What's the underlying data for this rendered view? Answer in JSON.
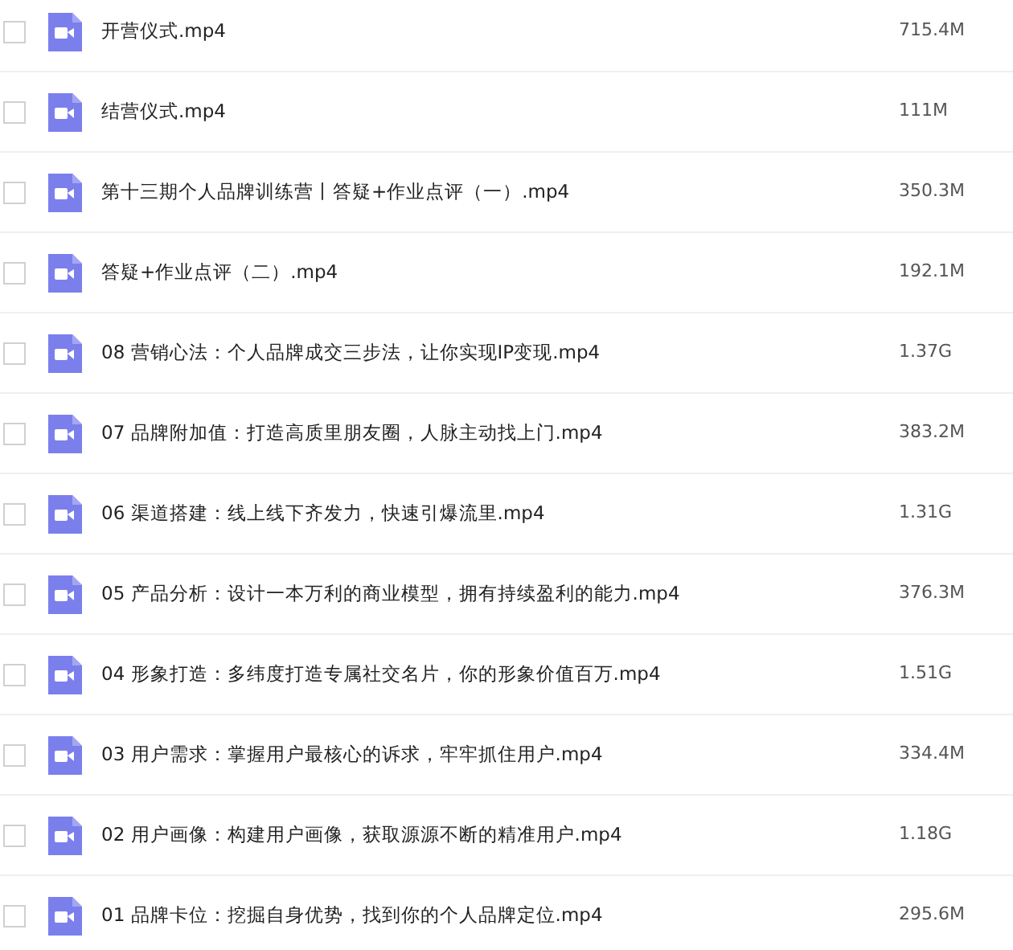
{
  "files": [
    {
      "name": "开营仪式.mp4",
      "size": "715.4M",
      "checked": false
    },
    {
      "name": "结营仪式.mp4",
      "size": "111M",
      "checked": false
    },
    {
      "name": "第十三期个人品牌训练营丨答疑+作业点评（一）.mp4",
      "size": "350.3M",
      "checked": false
    },
    {
      "name": "答疑+作业点评（二）.mp4",
      "size": "192.1M",
      "checked": false
    },
    {
      "name": "08 营销心法：个人品牌成交三步法，让你实现IP变现.mp4",
      "size": "1.37G",
      "checked": false
    },
    {
      "name": "07 品牌附加值：打造高质里朋友圈，人脉主动找上门.mp4",
      "size": "383.2M",
      "checked": false
    },
    {
      "name": "06 渠道搭建：线上线下齐发力，快速引爆流里.mp4",
      "size": "1.31G",
      "checked": false
    },
    {
      "name": "05 产品分析：设计一本万利的商业模型，拥有持续盈利的能力.mp4",
      "size": "376.3M",
      "checked": false
    },
    {
      "name": "04 形象打造：多纬度打造专属社交名片，你的形象价值百万.mp4",
      "size": "1.51G",
      "checked": false
    },
    {
      "name": "03 用户需求：掌握用户最核心的诉求，牢牢抓住用户.mp4",
      "size": "334.4M",
      "checked": false
    },
    {
      "name": "02 用户画像：构建用户画像，获取源源不断的精准用户.mp4",
      "size": "1.18G",
      "checked": false
    },
    {
      "name": "01 品牌卡位：挖掘自身优势，找到你的个人品牌定位.mp4",
      "size": "295.6M",
      "checked": false
    }
  ]
}
